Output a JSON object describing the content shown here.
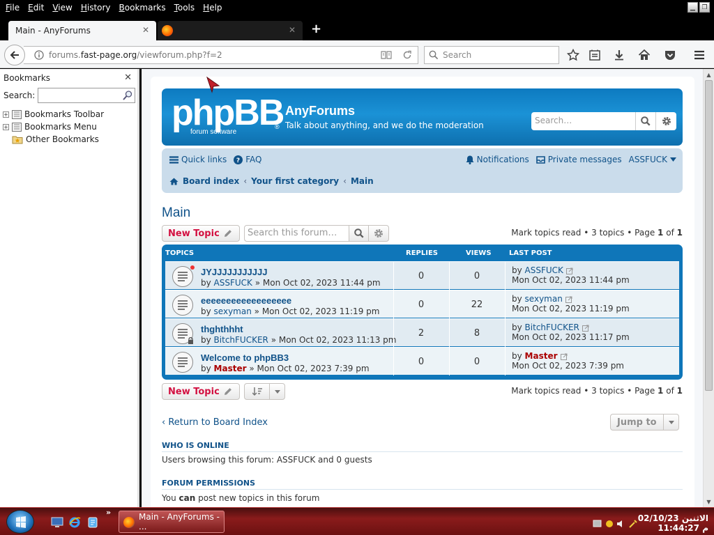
{
  "menubar": {
    "items": [
      "File",
      "Edit",
      "View",
      "History",
      "Bookmarks",
      "Tools",
      "Help"
    ],
    "underline": [
      "F",
      "E",
      "V",
      "H",
      "B",
      "T",
      "H"
    ]
  },
  "tabs": {
    "active_title": "Main - AnyForums",
    "close_glyph": "✕",
    "newtab_glyph": "+"
  },
  "nav": {
    "url_host": "forums.",
    "url_domain": "fast-page.org",
    "url_path": "/viewforum.php?f=2",
    "search_placeholder": "Search"
  },
  "sidebar": {
    "title": "Bookmarks",
    "search_label": "Search:",
    "close_glyph": "✕",
    "items": [
      "Bookmarks Toolbar",
      "Bookmarks Menu",
      "Other Bookmarks"
    ]
  },
  "header": {
    "site_name": "AnyForums",
    "site_desc": "Talk about anything, and we do the moderation",
    "search_placeholder": "Search…",
    "logo_text": "phpBB",
    "logo_sub": "forum  software",
    "logo_reg": "®"
  },
  "pnav": {
    "quick_links": "Quick links",
    "faq": "FAQ",
    "notifications": "Notifications",
    "private_messages": "Private messages",
    "username": "ASSFUCK",
    "crumbs": [
      "Board index",
      "Your first category",
      "Main"
    ],
    "crumb_sep": "‹"
  },
  "forum": {
    "title": "Main",
    "new_topic": "New Topic",
    "search_placeholder": "Search this forum…",
    "mark_read": "Mark topics read",
    "topic_count": "3 topics",
    "page_label": "Page",
    "page_num": "1",
    "of": "of",
    "page_total": "1",
    "sep": "•",
    "return_link": "Return to Board Index",
    "jump_to": "Jump to"
  },
  "table": {
    "headers": [
      "TOPICS",
      "REPLIES",
      "VIEWS",
      "LAST POST"
    ],
    "rows": [
      {
        "title": "JYJJJJJJJJJJJ",
        "by": "by",
        "author": "ASSFUCK",
        "date": "» Mon Oct 02, 2023 11:44 pm",
        "replies": "0",
        "views": "0",
        "lp_by": "by",
        "lp_author": "ASSFUCK",
        "lp_date": "Mon Oct 02, 2023 11:44 pm"
      },
      {
        "title": "eeeeeeeeeeeeeeeeee",
        "by": "by",
        "author": "sexyman",
        "date": "» Mon Oct 02, 2023 11:19 pm",
        "replies": "0",
        "views": "22",
        "lp_by": "by",
        "lp_author": "sexyman",
        "lp_date": "Mon Oct 02, 2023 11:19 pm"
      },
      {
        "title": "thghthhht",
        "by": "by",
        "author": "BitchFUCKER",
        "date": "» Mon Oct 02, 2023 11:13 pm",
        "replies": "2",
        "views": "8",
        "lp_by": "by",
        "lp_author": "BitchFUCKER",
        "lp_date": "Mon Oct 02, 2023 11:17 pm"
      },
      {
        "title": "Welcome to phpBB3",
        "by": "by",
        "author": "Master",
        "date": "» Mon Oct 02, 2023 7:39 pm",
        "replies": "0",
        "views": "0",
        "lp_by": "by",
        "lp_author": "Master",
        "lp_date": "Mon Oct 02, 2023 7:39 pm"
      }
    ]
  },
  "online": {
    "heading": "WHO IS ONLINE",
    "text": "Users browsing this forum: ASSFUCK and 0 guests"
  },
  "permissions": {
    "heading": "FORUM PERMISSIONS",
    "line1_pre": "You",
    "line1_strong": "can",
    "line1_post": "post new topics in this forum"
  },
  "taskbar": {
    "task_title": "Main - AnyForums - ...",
    "chevron": "»",
    "clock_day": "الاثنين 02/10/23",
    "clock_time": "م 11:44:27"
  },
  "colors": {
    "phpbb_blue": "#105289",
    "new_topic_red": "#d31141",
    "admin_red": "#aa0000"
  }
}
